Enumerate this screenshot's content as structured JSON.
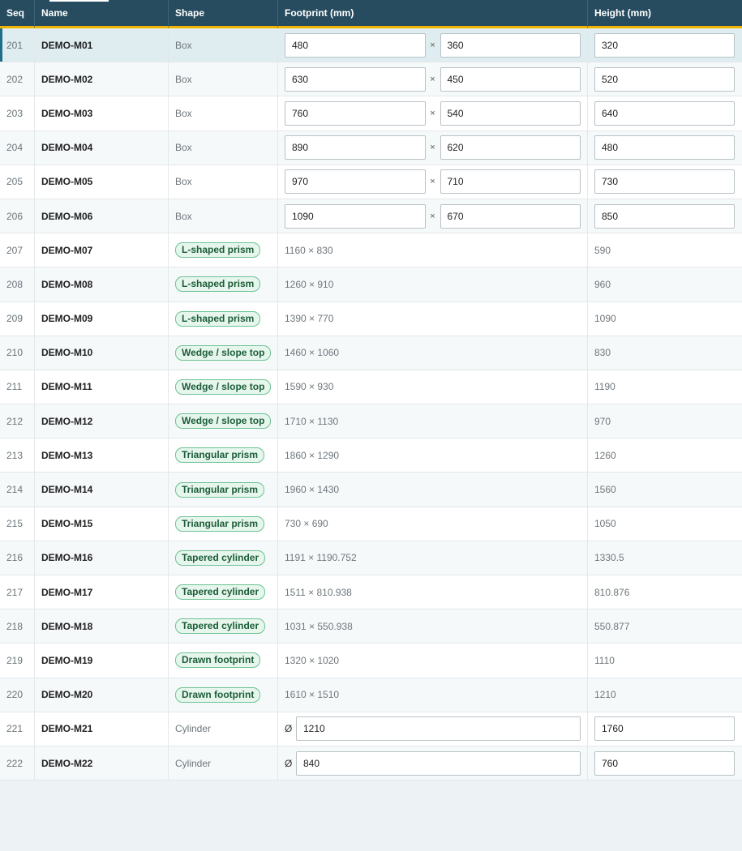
{
  "headers": {
    "seq": "Seq",
    "name": "Name",
    "shape": "Shape",
    "footprint": "Footprint (mm)",
    "height": "Height (mm)"
  },
  "times_symbol": "×",
  "diameter_symbol": "Ø",
  "rows": [
    {
      "seq": "201",
      "name": "DEMO-M01",
      "shape": "Box",
      "kind": "box",
      "w": "480",
      "d": "360",
      "h": "320",
      "selected": true
    },
    {
      "seq": "202",
      "name": "DEMO-M02",
      "shape": "Box",
      "kind": "box",
      "w": "630",
      "d": "450",
      "h": "520"
    },
    {
      "seq": "203",
      "name": "DEMO-M03",
      "shape": "Box",
      "kind": "box",
      "w": "760",
      "d": "540",
      "h": "640"
    },
    {
      "seq": "204",
      "name": "DEMO-M04",
      "shape": "Box",
      "kind": "box",
      "w": "890",
      "d": "620",
      "h": "480"
    },
    {
      "seq": "205",
      "name": "DEMO-M05",
      "shape": "Box",
      "kind": "box",
      "w": "970",
      "d": "710",
      "h": "730"
    },
    {
      "seq": "206",
      "name": "DEMO-M06",
      "shape": "Box",
      "kind": "box",
      "w": "1090",
      "d": "670",
      "h": "850"
    },
    {
      "seq": "207",
      "name": "DEMO-M07",
      "shape": "L-shaped prism",
      "kind": "badge",
      "footprint": "1160 × 830",
      "h": "590"
    },
    {
      "seq": "208",
      "name": "DEMO-M08",
      "shape": "L-shaped prism",
      "kind": "badge",
      "footprint": "1260 × 910",
      "h": "960"
    },
    {
      "seq": "209",
      "name": "DEMO-M09",
      "shape": "L-shaped prism",
      "kind": "badge",
      "footprint": "1390 × 770",
      "h": "1090"
    },
    {
      "seq": "210",
      "name": "DEMO-M10",
      "shape": "Wedge / slope top",
      "kind": "badge",
      "footprint": "1460 × 1060",
      "h": "830"
    },
    {
      "seq": "211",
      "name": "DEMO-M11",
      "shape": "Wedge / slope top",
      "kind": "badge",
      "footprint": "1590 × 930",
      "h": "1190"
    },
    {
      "seq": "212",
      "name": "DEMO-M12",
      "shape": "Wedge / slope top",
      "kind": "badge",
      "footprint": "1710 × 1130",
      "h": "970"
    },
    {
      "seq": "213",
      "name": "DEMO-M13",
      "shape": "Triangular prism",
      "kind": "badge",
      "footprint": "1860 × 1290",
      "h": "1260"
    },
    {
      "seq": "214",
      "name": "DEMO-M14",
      "shape": "Triangular prism",
      "kind": "badge",
      "footprint": "1960 × 1430",
      "h": "1560"
    },
    {
      "seq": "215",
      "name": "DEMO-M15",
      "shape": "Triangular prism",
      "kind": "badge",
      "footprint": "730 × 690",
      "h": "1050"
    },
    {
      "seq": "216",
      "name": "DEMO-M16",
      "shape": "Tapered cylinder",
      "kind": "badge",
      "footprint": "1191 × 1190.752",
      "h": "1330.5"
    },
    {
      "seq": "217",
      "name": "DEMO-M17",
      "shape": "Tapered cylinder",
      "kind": "badge",
      "footprint": "1511 × 810.938",
      "h": "810.876"
    },
    {
      "seq": "218",
      "name": "DEMO-M18",
      "shape": "Tapered cylinder",
      "kind": "badge",
      "footprint": "1031 × 550.938",
      "h": "550.877"
    },
    {
      "seq": "219",
      "name": "DEMO-M19",
      "shape": "Drawn footprint",
      "kind": "badge",
      "footprint": "1320 × 1020",
      "h": "1110"
    },
    {
      "seq": "220",
      "name": "DEMO-M20",
      "shape": "Drawn footprint",
      "kind": "badge",
      "footprint": "1610 × 1510",
      "h": "1210"
    },
    {
      "seq": "221",
      "name": "DEMO-M21",
      "shape": "Cylinder",
      "kind": "cyl",
      "dia": "1210",
      "h": "1760"
    },
    {
      "seq": "222",
      "name": "DEMO-M22",
      "shape": "Cylinder",
      "kind": "cyl",
      "dia": "840",
      "h": "760"
    }
  ]
}
